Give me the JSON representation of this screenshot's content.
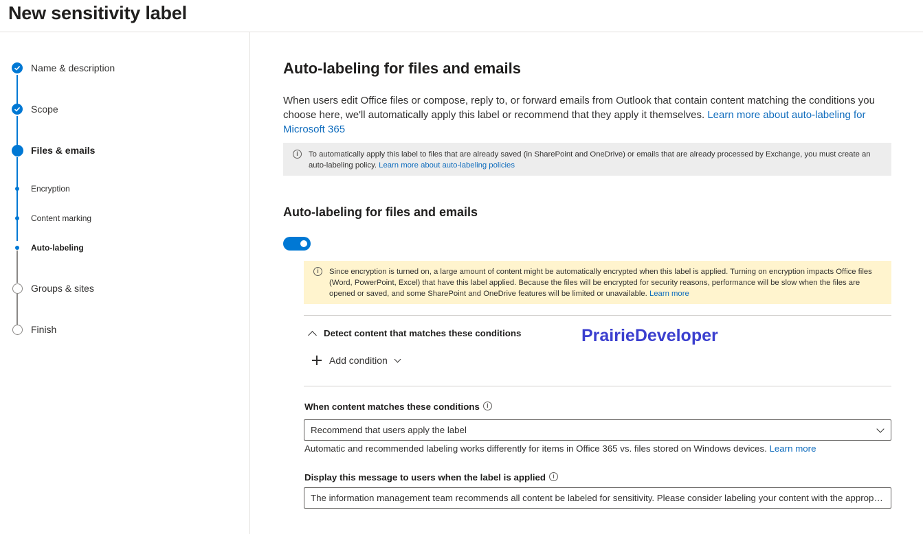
{
  "page": {
    "title": "New sensitivity label"
  },
  "stepper": {
    "steps": [
      {
        "label": "Name & description",
        "state": "done"
      },
      {
        "label": "Scope",
        "state": "done"
      },
      {
        "label": "Files & emails",
        "state": "current"
      },
      {
        "label": "Encryption",
        "state": "sub-done"
      },
      {
        "label": "Content marking",
        "state": "sub-done"
      },
      {
        "label": "Auto-labeling",
        "state": "sub-current"
      },
      {
        "label": "Groups & sites",
        "state": "todo"
      },
      {
        "label": "Finish",
        "state": "todo"
      }
    ],
    "accent_color": "#0078d4"
  },
  "main": {
    "heading": "Auto-labeling for files and emails",
    "intro_text": "When users edit Office files or compose, reply to, or forward emails from Outlook that contain content matching the conditions you choose here, we'll automatically apply this label or recommend that they apply it themselves.",
    "intro_link": "Learn more about auto-labeling for Microsoft 365",
    "info_gray": {
      "icon": "info-icon",
      "text": "To automatically apply this label to files that are already saved (in SharePoint and OneDrive) or emails that are already processed by Exchange, you must create an auto-labeling policy.",
      "link": "Learn more about auto-labeling policies"
    },
    "section_heading": "Auto-labeling for files and emails",
    "toggle": {
      "on": true
    },
    "info_yellow": {
      "icon": "info-icon",
      "text": "Since encryption is turned on, a large amount of content might be automatically encrypted when this label is applied. Turning on encryption impacts Office files (Word, PowerPoint, Excel) that have this label applied. Because the files will be encrypted for security reasons, performance will be slow when the files are opened or saved, and some SharePoint and OneDrive features will be limited or unavailable.",
      "link": "Learn more"
    },
    "detect_heading": "Detect content that matches these conditions",
    "watermark": "PrairieDeveloper",
    "add_condition": "Add condition",
    "when_label": "When content matches these conditions",
    "when_value": "Recommend that users apply the label",
    "helper_text": "Automatic and recommended labeling works differently for items in Office 365 vs. files stored on Windows devices.",
    "helper_link": "Learn more",
    "message_label": "Display this message to users when the label is applied",
    "message_value": "The information management team recommends all content be labeled for sensitivity.  Please consider labeling your content with the appropriate label."
  }
}
